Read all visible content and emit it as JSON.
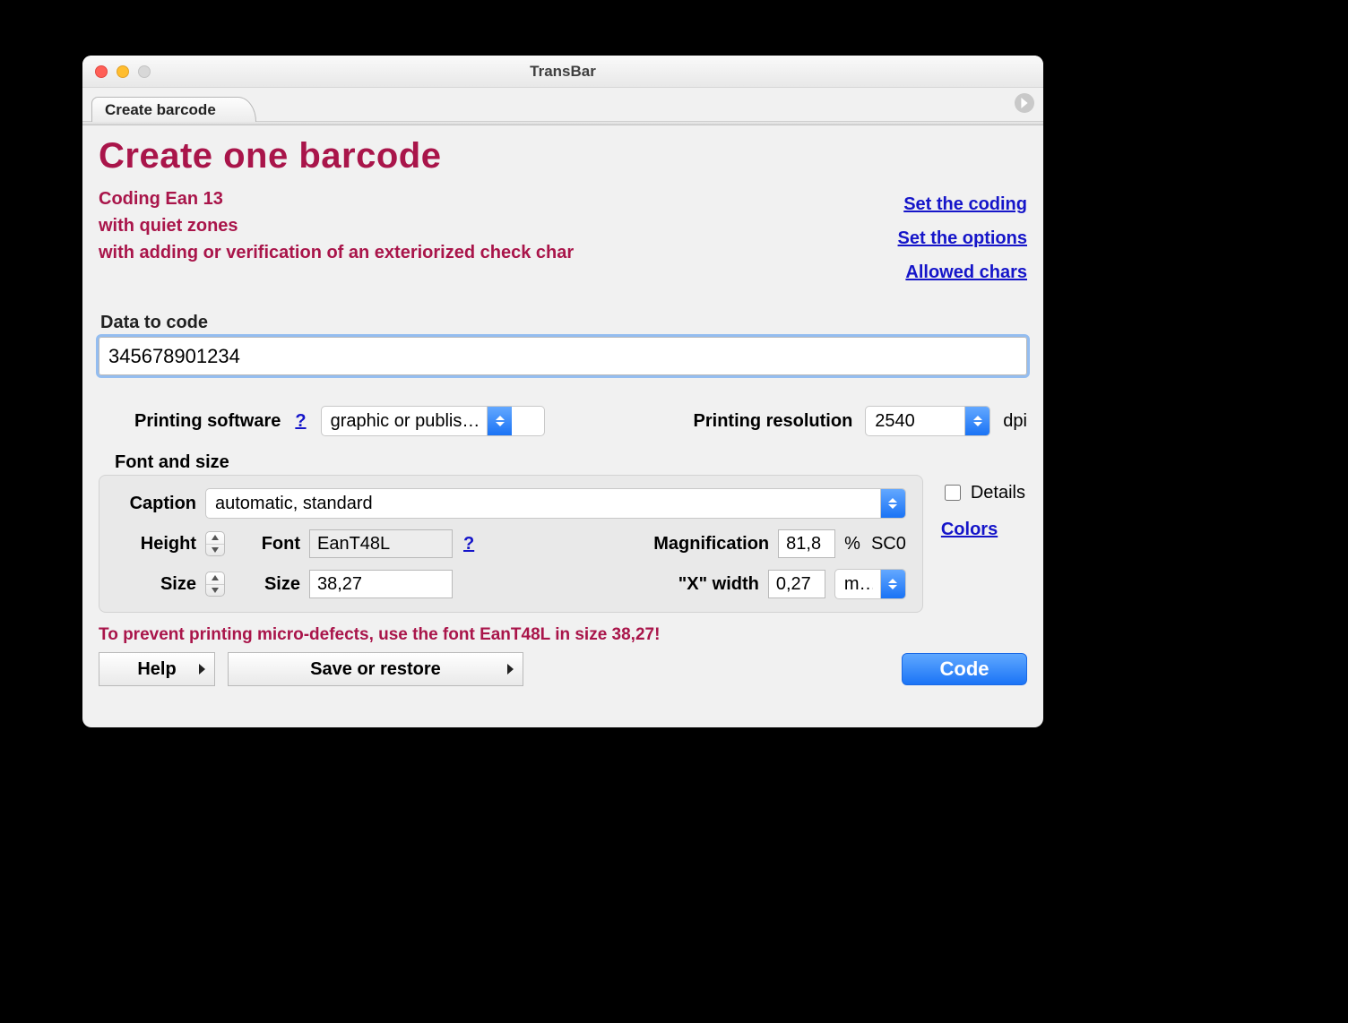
{
  "window": {
    "title": "TransBar"
  },
  "tab": {
    "label": "Create barcode"
  },
  "heading": "Create one barcode",
  "summary": {
    "line1": "Coding Ean 13",
    "line2": "with quiet zones",
    "line3": "with adding or verification of an exteriorized check char"
  },
  "links": {
    "set_coding": "Set the coding",
    "set_options": "Set the options",
    "allowed_chars": "Allowed chars"
  },
  "data_to_code": {
    "label": "Data to code",
    "value": "345678901234"
  },
  "printing_software": {
    "label": "Printing software",
    "help": "?",
    "value": "graphic or publis…"
  },
  "printing_resolution": {
    "label": "Printing resolution",
    "value": "2540",
    "unit": "dpi"
  },
  "font_section_label": "Font and size",
  "caption": {
    "label": "Caption",
    "value": "automatic, standard"
  },
  "height_label": "Height",
  "font": {
    "label": "Font",
    "value": "EanT48L",
    "help": "?"
  },
  "magnification": {
    "label": "Magnification",
    "value": "81,8",
    "percent": "%",
    "sc": "SC0"
  },
  "size_row_label": "Size",
  "size": {
    "label": "Size",
    "value": "38,27"
  },
  "xwidth": {
    "label": "\"X\" width",
    "value": "0,27",
    "unit": "mm"
  },
  "details_label": "Details",
  "colors_link": "Colors",
  "warning": "To prevent printing micro-defects, use the font EanT48L in size 38,27!",
  "buttons": {
    "help": "Help",
    "save_restore": "Save or restore",
    "code": "Code"
  }
}
